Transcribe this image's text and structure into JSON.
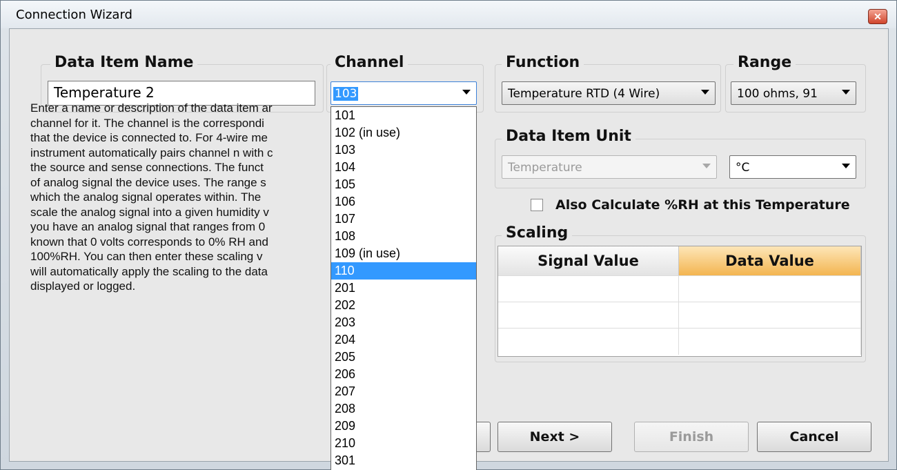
{
  "window": {
    "title": "Connection Wizard",
    "close_glyph": "✕"
  },
  "data_item_name": {
    "title": "Data Item Name",
    "value": "Temperature 2"
  },
  "channel": {
    "title": "Channel",
    "selected": "103",
    "options": [
      "101",
      "102 (in use)",
      "103",
      "104",
      "105",
      "106",
      "107",
      "108",
      "109 (in use)",
      "110",
      "201",
      "202",
      "203",
      "204",
      "205",
      "206",
      "207",
      "208",
      "209",
      "210",
      "301"
    ],
    "highlighted_index": 9
  },
  "function": {
    "title": "Function",
    "selected": "Temperature RTD (4 Wire)"
  },
  "range": {
    "title": "Range",
    "selected": "100 ohms, 91"
  },
  "data_item_unit": {
    "title": "Data Item Unit",
    "quantity": "Temperature",
    "unit": "°C"
  },
  "rh_checkbox": {
    "label": "Also Calculate %RH at this Temperature",
    "checked": false
  },
  "description_lines": [
    "Enter a name or description of the data item ar",
    "channel for it.  The channel is the correspondi",
    "that the device is connected to.  For 4-wire me",
    "instrument automatically pairs channel n with c",
    "the source and sense connections.  The funct",
    "of analog signal the device uses.  The range s",
    "which the analog signal operates within.  The",
    "scale the analog signal into a given humidity v",
    "you have an analog signal that ranges from 0",
    "known that 0 volts corresponds to 0% RH and",
    "100%RH.  You can then enter these scaling v",
    "will automatically apply the scaling to the data",
    "displayed or logged."
  ],
  "scaling": {
    "title": "Scaling",
    "col_signal": "Signal Value",
    "col_data": "Data Value"
  },
  "buttons": {
    "next": "Next >",
    "finish": "Finish",
    "cancel": "Cancel"
  },
  "colors": {
    "selection": "#3399ff",
    "data_header": "#f3b550"
  }
}
